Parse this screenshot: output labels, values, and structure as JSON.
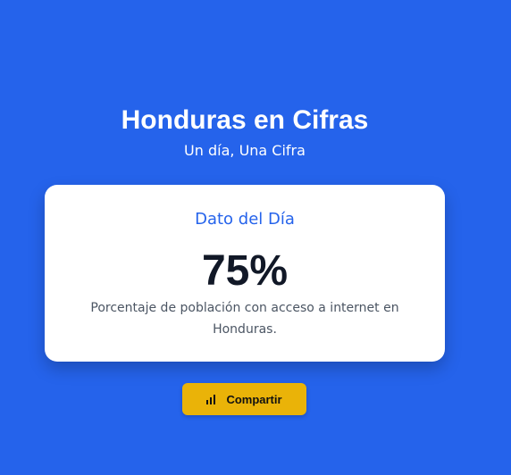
{
  "header": {
    "title": "Honduras en Cifras",
    "subtitle": "Un día, Una Cifra"
  },
  "card": {
    "label": "Dato del Día",
    "value": "75%",
    "description": "Porcentaje de población con acceso a internet en Honduras."
  },
  "actions": {
    "share_label": "Compartir",
    "share_icon": "bar-chart-icon"
  },
  "colors": {
    "background": "#2563eb",
    "accent": "#2563eb",
    "button": "#eab308",
    "card": "#ffffff",
    "value_text": "#111827"
  }
}
